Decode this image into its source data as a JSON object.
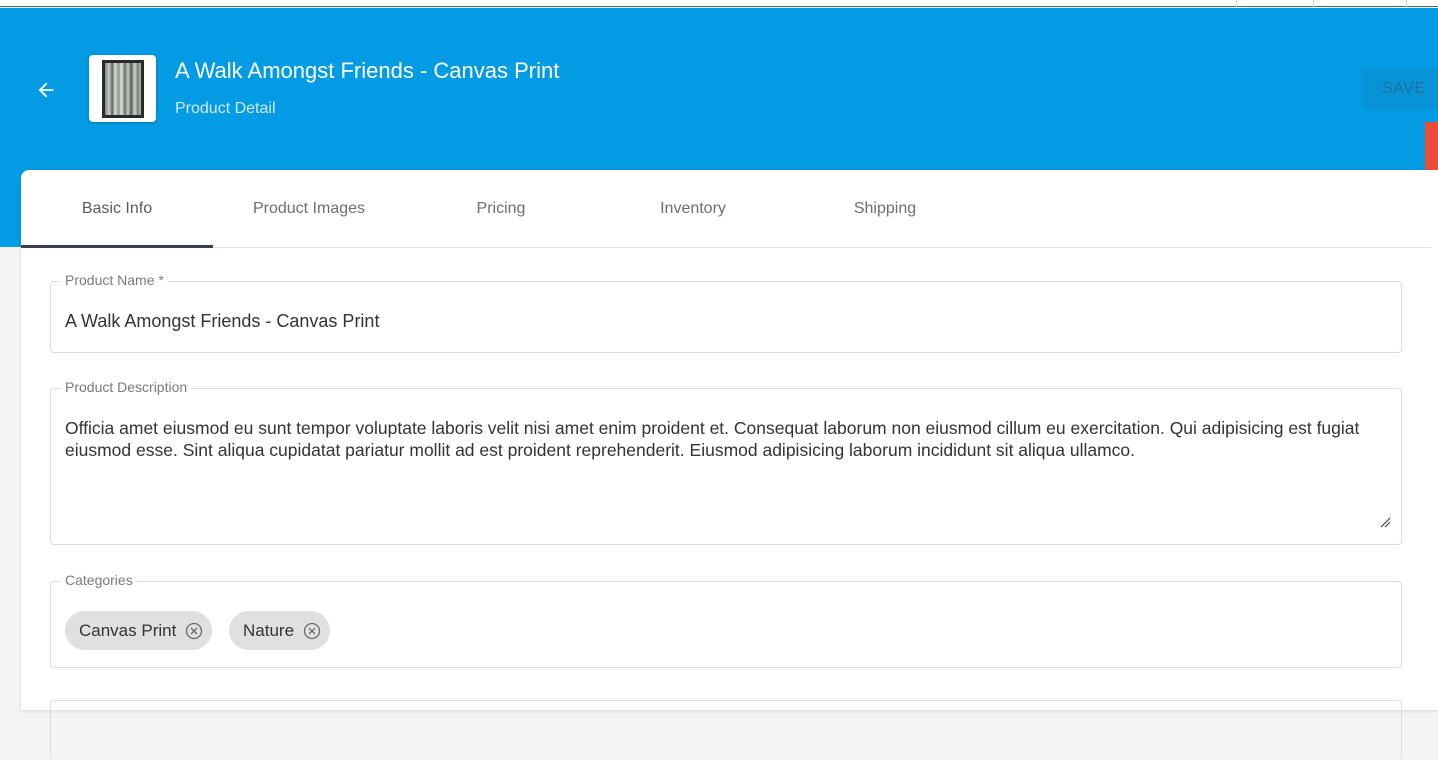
{
  "header": {
    "title": "A Walk Amongst Friends - Canvas Print",
    "subtitle": "Product Detail",
    "save_label": "SAVE",
    "background": "#049be5"
  },
  "tabs": [
    {
      "label": "Basic Info",
      "active": true
    },
    {
      "label": "Product Images",
      "active": false
    },
    {
      "label": "Pricing",
      "active": false
    },
    {
      "label": "Inventory",
      "active": false
    },
    {
      "label": "Shipping",
      "active": false
    }
  ],
  "form": {
    "product_name": {
      "label": "Product Name *",
      "value": "A Walk Amongst Friends - Canvas Print"
    },
    "product_description": {
      "label": "Product Description",
      "value": "Officia amet eiusmod eu sunt tempor voluptate laboris velit nisi amet enim proident et. Consequat laborum non eiusmod cillum eu exercitation. Qui adipisicing est fugiat eiusmod esse. Sint aliqua cupidatat pariatur mollit ad est proident reprehenderit. Eiusmod adipisicing laborum incididunt sit aliqua ullamco."
    },
    "categories": {
      "label": "Categories",
      "chips": [
        "Canvas Print",
        "Nature"
      ]
    },
    "next_field": {
      "label": ""
    }
  },
  "icons": {
    "back": "arrow-back-icon",
    "chip_remove": "cancel-circle-icon",
    "resize": "resize-handle-icon"
  }
}
